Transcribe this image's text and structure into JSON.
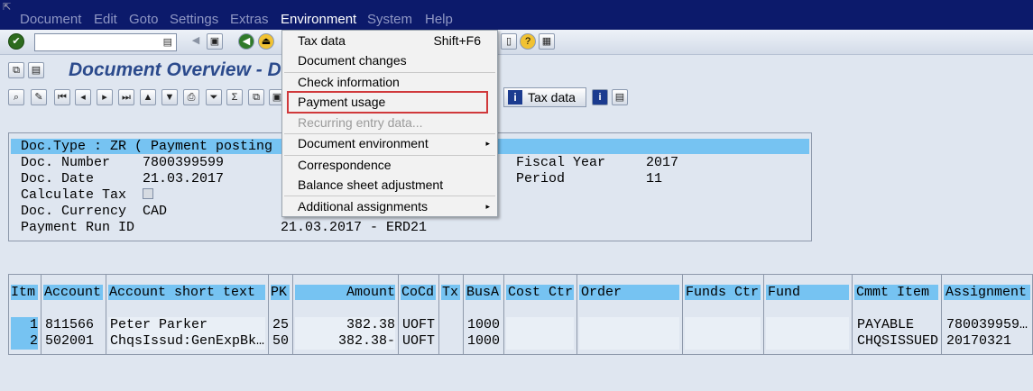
{
  "menubar": {
    "items": [
      {
        "label": "Document"
      },
      {
        "label": "Edit"
      },
      {
        "label": "Goto"
      },
      {
        "label": "Settings"
      },
      {
        "label": "Extras"
      },
      {
        "label": "Environment",
        "active": true
      },
      {
        "label": "System"
      },
      {
        "label": "Help"
      }
    ]
  },
  "toolbar": {
    "command_value": ""
  },
  "page": {
    "title": "Document Overview - D"
  },
  "app_toolbar": {
    "tax_data_label": "Tax data"
  },
  "header": {
    "doc_type": "Doc.Type : ZR ( Payment posting",
    "doc_number_label": "Doc. Number",
    "doc_number": "7800399599",
    "doc_date_label": "Doc. Date",
    "doc_date": "21.03.2017",
    "calc_tax_label": "Calculate Tax",
    "doc_currency_label": "Doc. Currency",
    "doc_currency": "CAD",
    "payment_run_label": "Payment Run ID",
    "payment_run": "21.03.2017 - ERD21",
    "fiscal_year_label": "Fiscal Year",
    "fiscal_year": "2017",
    "period_label": "Period",
    "period": "11"
  },
  "table": {
    "columns": [
      "Itm",
      "Account",
      "Account short text",
      "PK",
      "Amount",
      "CoCd",
      "Tx",
      "BusA",
      "Cost Ctr",
      "Order",
      "Funds Ctr",
      "Fund",
      "Cmmt Item",
      "Assignment"
    ],
    "rows": [
      {
        "itm": "1",
        "account": "811566",
        "text": "Peter Parker",
        "pk": "25",
        "amount": "382.38",
        "cocd": "UOFT",
        "tx": "",
        "busa": "1000",
        "cmmt": "PAYABLE",
        "assignment": "780039959…"
      },
      {
        "itm": "2",
        "account": "502001",
        "text": "ChqsIssud:GenExpBk…",
        "pk": "50",
        "amount": "382.38-",
        "cocd": "UOFT",
        "tx": "",
        "busa": "1000",
        "cmmt": "CHQSISSUED",
        "assignment": "20170321"
      }
    ]
  },
  "environment_menu": {
    "items": [
      {
        "label": "Tax data",
        "shortcut": "Shift+F6"
      },
      {
        "label": "Document changes"
      },
      {
        "label": "Check information"
      },
      {
        "label": "Payment usage",
        "highlighted": true
      },
      {
        "label": "Recurring entry data...",
        "disabled": true
      },
      {
        "label": "Document environment",
        "submenu": true
      },
      {
        "label": "Correspondence"
      },
      {
        "label": "Balance sheet adjustment"
      },
      {
        "label": "Additional assignments",
        "submenu": true
      }
    ]
  },
  "colors": {
    "menubar_bg": "#0c1a6b",
    "header_bar": "#76c3f2",
    "title_text": "#2b4a8c",
    "highlight_border": "#d0393b"
  }
}
